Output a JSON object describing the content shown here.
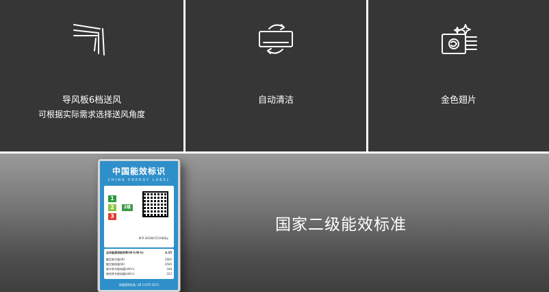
{
  "features": [
    {
      "title": "导风板6档送风",
      "subtitle": "可根据实际需求选择送风角度",
      "icon": "louver-airflow-icon"
    },
    {
      "title": "自动清洁",
      "icon": "self-clean-icon"
    },
    {
      "title": "金色翅片",
      "icon": "golden-fin-icon"
    }
  ],
  "energy": {
    "headline": "国家二级能效标准",
    "label_title": "中国能效标识",
    "label_subtitle": "CHINA ENERGY LABEL",
    "grades": [
      "1",
      "2",
      "3"
    ],
    "current_grade": "2级",
    "model": "KFR-26GW/(52108)Ep",
    "ratio_label": "全年能源消耗效率(W·h/W·h)",
    "ratio_value": "4.35",
    "specs": [
      {
        "name": "额定制冷量(W)",
        "value": "2600"
      },
      {
        "name": "额定制热量(W)",
        "value": "3500"
      },
      {
        "name": "制冷季节耗电量(kW·h)",
        "value": "348"
      },
      {
        "name": "制热季节耗电量(kW·h)",
        "value": "222"
      }
    ],
    "standard": "依据国家标准: GB 21455-2013"
  }
}
